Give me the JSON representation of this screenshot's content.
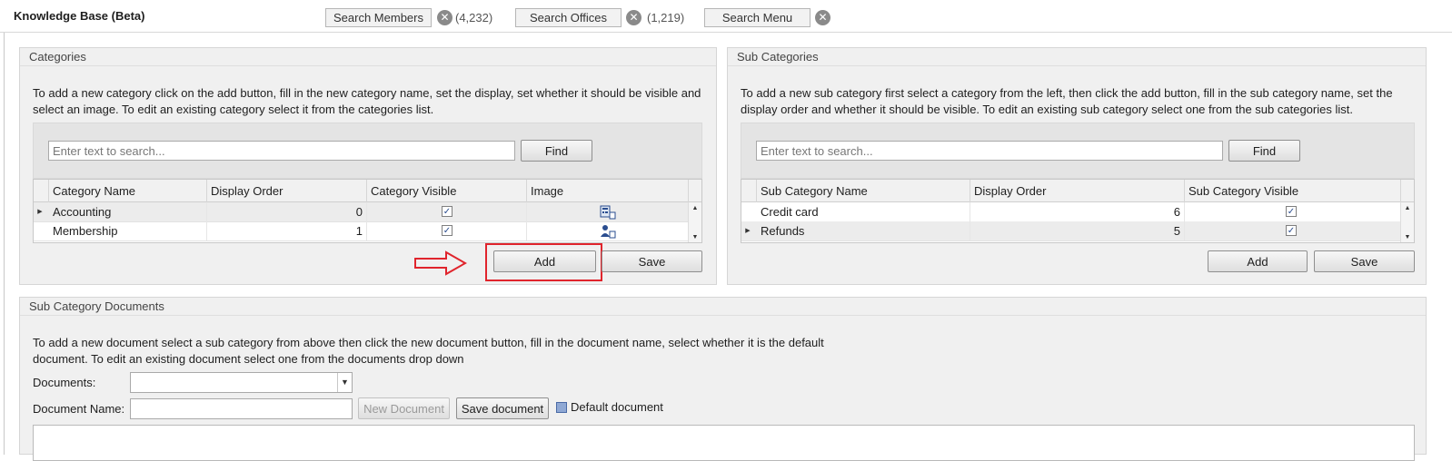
{
  "header": {
    "title": "Knowledge Base (Beta)",
    "search_members_label": "Search Members",
    "members_count": "(4,232)",
    "search_offices_label": "Search Offices",
    "offices_count": "(1,219)",
    "search_menu_label": "Search Menu"
  },
  "categories": {
    "title": "Categories",
    "description": "To add a new category click on the add button, fill in the new category name, set the display, set whether it should be visible and select an image. To edit an existing category select it from the categories list.",
    "search_placeholder": "Enter text to search...",
    "find_label": "Find",
    "columns": [
      "Category Name",
      "Display Order",
      "Category Visible",
      "Image"
    ],
    "rows": [
      {
        "name": "Accounting",
        "order": "0",
        "visible": true,
        "image": "report-icon"
      },
      {
        "name": "Membership",
        "order": "1",
        "visible": true,
        "image": "user-icon"
      }
    ],
    "add_label": "Add",
    "save_label": "Save"
  },
  "subcategories": {
    "title": "Sub Categories",
    "description": "To add a new sub category first select a category from the left, then click the add button, fill in the sub category name, set the display order and whether it should be visible. To edit an existing sub category select one from the sub categories list.",
    "search_placeholder": "Enter text to search...",
    "find_label": "Find",
    "columns": [
      "Sub Category Name",
      "Display Order",
      "Sub Category Visible"
    ],
    "rows": [
      {
        "name": "Credit card",
        "order": "6",
        "visible": true
      },
      {
        "name": "Refunds",
        "order": "5",
        "visible": true
      }
    ],
    "add_label": "Add",
    "save_label": "Save"
  },
  "documents": {
    "title": "Sub Category Documents",
    "description": "To add a new document select a sub category from above then click the new document button, fill in the document name, select whether it is the default document. To edit an existing document select one from the documents drop down",
    "documents_label": "Documents:",
    "documents_value": "",
    "document_name_label": "Document Name:",
    "document_name_value": "",
    "new_document_label": "New Document",
    "save_document_label": "Save document",
    "default_document_label": "Default document"
  },
  "colors": {
    "highlight": "#e0242c",
    "accent": "#2a4d8f"
  }
}
